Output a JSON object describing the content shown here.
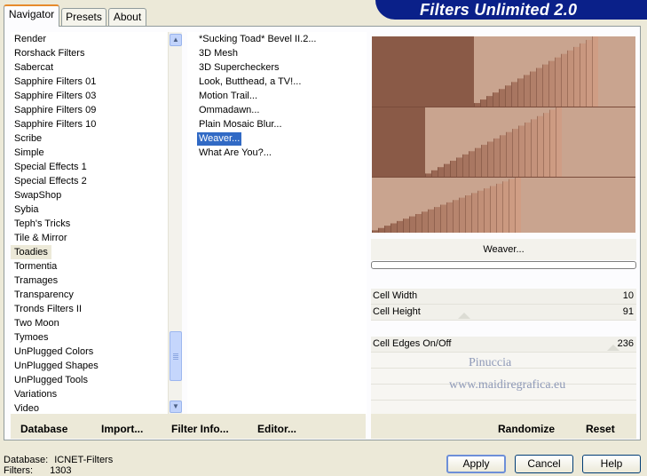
{
  "app": {
    "banner_title": "Filters Unlimited 2.0"
  },
  "tabs": [
    {
      "label": "Navigator",
      "active": true
    },
    {
      "label": "Presets",
      "active": false
    },
    {
      "label": "About",
      "active": false
    }
  ],
  "categories": {
    "items": [
      "Render",
      "Rorshack Filters",
      "Sabercat",
      "Sapphire Filters 01",
      "Sapphire Filters 03",
      "Sapphire Filters 09",
      "Sapphire Filters 10",
      "Scribe",
      "Simple",
      "Special Effects 1",
      "Special Effects 2",
      "SwapShop",
      "Sybia",
      "Teph's Tricks",
      "Tile & Mirror",
      "Toadies",
      "Tormentia",
      "Tramages",
      "Transparency",
      "Tronds Filters II",
      "Two Moon",
      "Tymoes",
      "UnPlugged Colors",
      "UnPlugged Shapes",
      "UnPlugged Tools",
      "Variations",
      "Video"
    ],
    "selected": "Toadies"
  },
  "filters": {
    "items": [
      "*Sucking Toad*  Bevel II.2...",
      "3D Mesh",
      "3D Supercheckers",
      "Look, Butthead, a TV!...",
      "Motion Trail...",
      "Ommadawn...",
      "Plain Mosaic Blur...",
      "Weaver...",
      "What Are You?..."
    ],
    "selected": "Weaver..."
  },
  "preview": {
    "filter_name": "Weaver..."
  },
  "params": [
    {
      "label": "Cell Width",
      "value": "10"
    },
    {
      "label": "Cell Height",
      "value": "91"
    },
    {
      "label": "Cell Edges On/Off",
      "value": "236"
    }
  ],
  "watermark": {
    "line1": "Pinuccia",
    "line2": "www.maidiregrafica.eu"
  },
  "bottom_links": {
    "database": "Database",
    "import": "Import...",
    "filter_info": "Filter Info...",
    "editor": "Editor...",
    "randomize": "Randomize",
    "reset": "Reset"
  },
  "buttons": {
    "apply": "Apply",
    "cancel": "Cancel",
    "help": "Help"
  },
  "status": {
    "database_label": "Database:",
    "database_value": "ICNET-Filters",
    "filters_label": "Filters:",
    "filters_value": "1303"
  },
  "colors": {
    "banner": "#0a2089",
    "selection": "#316ac5",
    "tab_accent": "#e68b2c"
  },
  "icons": {
    "scroll_up": "chevron-up-icon",
    "scroll_down": "chevron-down-icon"
  }
}
